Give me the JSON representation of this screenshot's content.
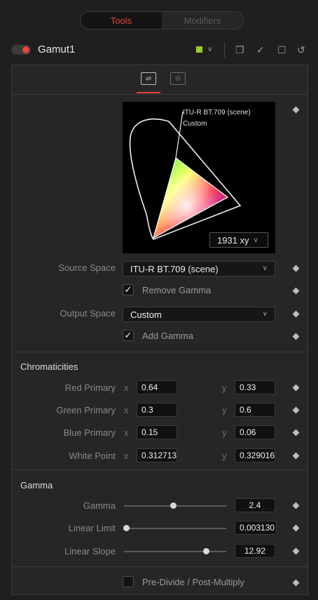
{
  "tabs": {
    "active": "Tools",
    "inactive": "Modifiers"
  },
  "node": {
    "title": "Gamut1",
    "enabled": true,
    "color_chip": "#9ccc2a"
  },
  "header_icons": [
    "color-chip-dropdown-icon",
    "window-icon",
    "pin-icon",
    "lock-icon",
    "reset-icon"
  ],
  "subtabs": [
    "controls-icon",
    "settings-icon"
  ],
  "chart": {
    "label_source": "ITU-R BT.709 (scene)",
    "label_output": "Custom",
    "view_mode": "1931 xy"
  },
  "source_space": {
    "label": "Source Space",
    "value": "ITU-R BT.709 (scene)"
  },
  "remove_gamma": {
    "label": "Remove Gamma",
    "checked": true
  },
  "output_space": {
    "label": "Output Space",
    "value": "Custom"
  },
  "add_gamma": {
    "label": "Add Gamma",
    "checked": true
  },
  "chromaticities": {
    "title": "Chromaticities",
    "rows": [
      {
        "label": "Red Primary",
        "x": "0.64",
        "y": "0.33"
      },
      {
        "label": "Green Primary",
        "x": "0.3",
        "y": "0.6"
      },
      {
        "label": "Blue Primary",
        "x": "0.15",
        "y": "0.06"
      },
      {
        "label": "White Point",
        "x": "0.312713",
        "y": "0.329016"
      }
    ],
    "axis_x": "x",
    "axis_y": "y"
  },
  "gamma": {
    "title": "Gamma",
    "rows": [
      {
        "label": "Gamma",
        "value": "2.4",
        "level": 0.48
      },
      {
        "label": "Linear Limit",
        "value": "0.003130",
        "level": 0.02
      },
      {
        "label": "Linear Slope",
        "value": "12.92",
        "level": 0.8
      }
    ]
  },
  "predivide": {
    "label": "Pre-Divide / Post-Multiply",
    "checked": false
  },
  "colors": {
    "accent": "#e8453c",
    "panel": "#262626",
    "background": "#1f1f1f"
  }
}
